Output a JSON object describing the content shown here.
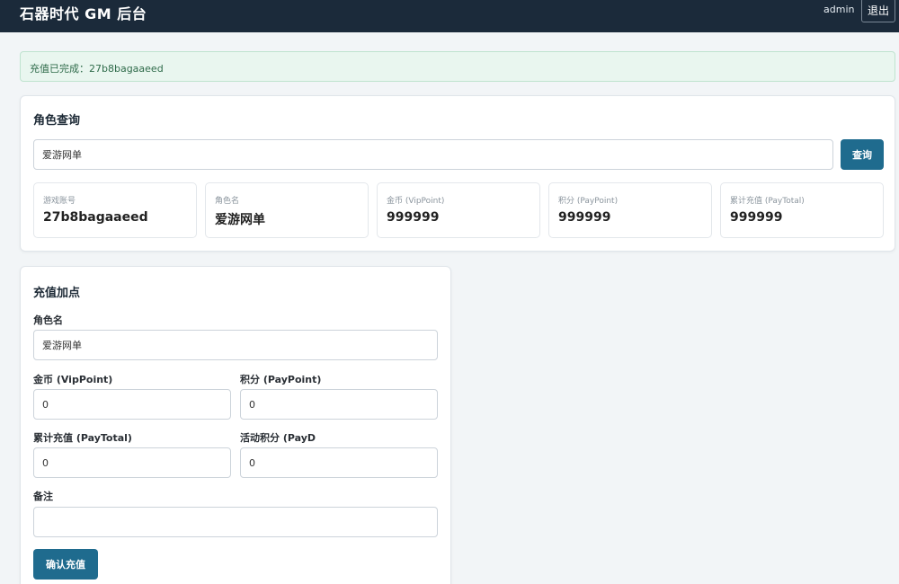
{
  "header": {
    "title": "石器时代 GM 后台",
    "user": "admin",
    "logout_label": "退出"
  },
  "alert": {
    "message": "充值已完成：27b8bagaaeed"
  },
  "query": {
    "title": "角色查询",
    "input_value": "爱游网单",
    "search_label": "查询",
    "stats": [
      {
        "label": "游戏账号",
        "value": "27b8bagaaeed"
      },
      {
        "label": "角色名",
        "value": "爱游网单"
      },
      {
        "label": "金币 (VipPoint)",
        "value": "999999"
      },
      {
        "label": "积分 (PayPoint)",
        "value": "999999"
      },
      {
        "label": "累计充值 (PayTotal)",
        "value": "999999"
      }
    ]
  },
  "recharge": {
    "title": "充值加点",
    "role_label": "角色名",
    "role_value": "爱游网单",
    "vip_label": "金币 (VipPoint)",
    "vip_value": "0",
    "pay_label": "积分 (PayPoint)",
    "pay_value": "0",
    "total_label": "累计充值 (PayTotal)",
    "total_value": "0",
    "activity_label": "活动积分 (PayD",
    "activity_value": "0",
    "note_label": "备注",
    "note_value": "",
    "submit_label": "确认充值"
  }
}
